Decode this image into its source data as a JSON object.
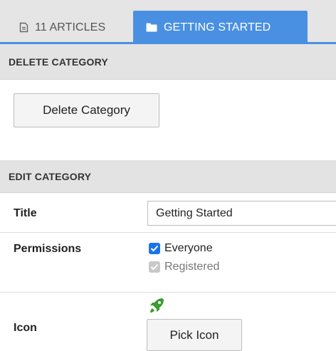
{
  "tabs": {
    "articles_label": "11 ARTICLES",
    "articles_icon": "document-icon",
    "category_label": "GETTING STARTED",
    "category_icon": "folder-icon"
  },
  "delete_section": {
    "header": "DELETE CATEGORY",
    "button_label": "Delete Category"
  },
  "edit_section": {
    "header": "EDIT CATEGORY",
    "title_label": "Title",
    "title_value": "Getting Started",
    "permissions_label": "Permissions",
    "permissions": [
      {
        "label": "Everyone",
        "checked": true,
        "disabled": false
      },
      {
        "label": "Registered",
        "checked": true,
        "disabled": true
      }
    ],
    "icon_label": "Icon",
    "icon_name": "rocket-icon",
    "icon_color": "#3a9d2f",
    "pick_icon_label": "Pick Icon"
  },
  "colors": {
    "accent": "#4a90e2",
    "checkbox": "#1a73e8"
  }
}
